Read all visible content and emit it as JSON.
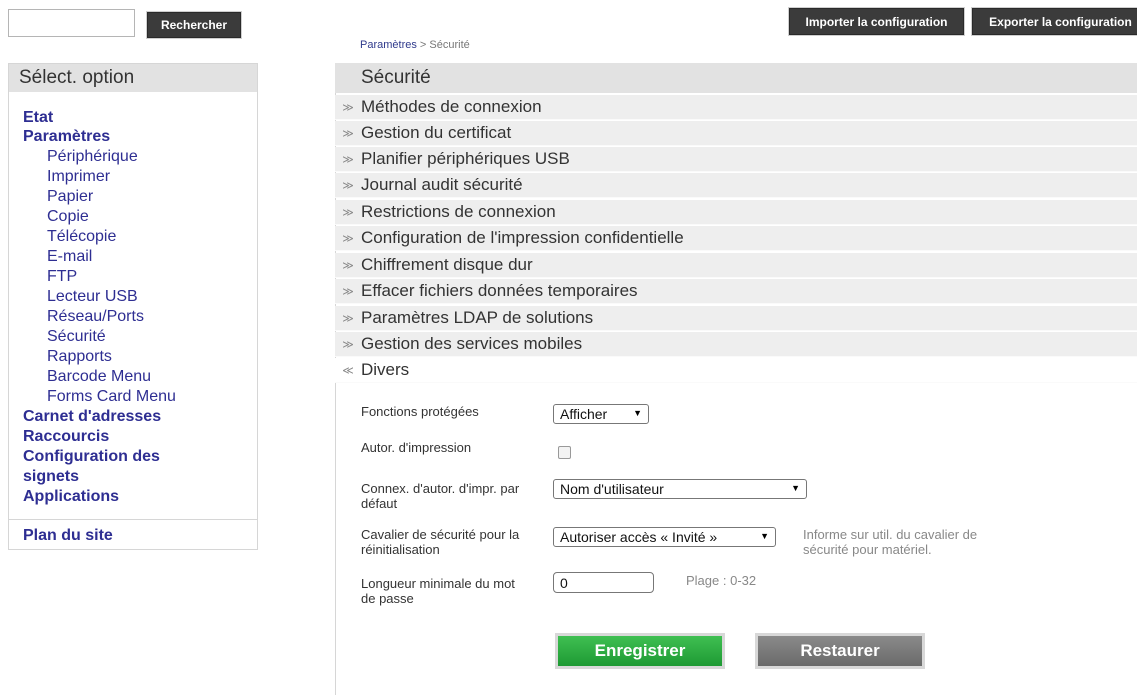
{
  "search": {
    "value": "",
    "button_label": "Rechercher"
  },
  "toolbar": {
    "import_label": "Importer la configuration",
    "export_label": "Exporter la configuration"
  },
  "breadcrumb": {
    "parent": "Paramètres",
    "separator": " > ",
    "current": "Sécurité"
  },
  "sidebar": {
    "title": "Sélect. option",
    "items": [
      {
        "label": "Etat"
      },
      {
        "label": "Paramètres"
      },
      {
        "label": "Périphérique"
      },
      {
        "label": "Imprimer"
      },
      {
        "label": "Papier"
      },
      {
        "label": "Copie"
      },
      {
        "label": "Télécopie"
      },
      {
        "label": "E-mail"
      },
      {
        "label": "FTP"
      },
      {
        "label": "Lecteur USB"
      },
      {
        "label": "Réseau/Ports"
      },
      {
        "label": "Sécurité"
      },
      {
        "label": "Rapports"
      },
      {
        "label": "Barcode Menu"
      },
      {
        "label": "Forms Card Menu"
      },
      {
        "label": "Carnet d'adresses"
      },
      {
        "label": "Raccourcis"
      },
      {
        "label": "Configuration des"
      },
      {
        "label": "signets"
      },
      {
        "label": "Applications"
      }
    ],
    "site_map": "Plan du site"
  },
  "main": {
    "title": "Sécurité",
    "sections": [
      {
        "label": "Méthodes de connexion"
      },
      {
        "label": "Gestion du certificat"
      },
      {
        "label": "Planifier périphériques USB"
      },
      {
        "label": "Journal audit sécurité"
      },
      {
        "label": "Restrictions de connexion"
      },
      {
        "label": "Configuration de l'impression confidentielle"
      },
      {
        "label": "Chiffrement disque dur"
      },
      {
        "label": "Effacer fichiers données temporaires"
      },
      {
        "label": "Paramètres LDAP de solutions"
      },
      {
        "label": "Gestion des services mobiles"
      },
      {
        "label": "Divers"
      }
    ],
    "chevron_collapsed": "≫",
    "chevron_expanded": "≪",
    "form": {
      "protected_label": "Fonctions protégées",
      "protected_value": "Afficher",
      "print_auth_label": "Autor. d'impression",
      "print_auth_checked": false,
      "default_login_label_1": "Connex. d'autor. d'impr. par",
      "default_login_label_2": "défaut",
      "default_login_value": "Nom d'utilisateur",
      "jumper_label_1": "Cavalier de sécurité pour la",
      "jumper_label_2": "réinitialisation",
      "jumper_value": "Autoriser accès « Invité »",
      "jumper_hint_1": "Informe sur util. du cavalier de",
      "jumper_hint_2": "sécurité pour matériel.",
      "pwd_label_1": "Longueur minimale du mot",
      "pwd_label_2": "de passe",
      "pwd_value": "0",
      "pwd_hint": "Plage : 0-32"
    },
    "save_label": "Enregistrer",
    "restore_label": "Restaurer"
  },
  "colors": {
    "save": "#2eaa42",
    "restore": "#7a7a7a",
    "nav_link": "#2e2e92",
    "toolbar_button": "#3b3b3b"
  }
}
